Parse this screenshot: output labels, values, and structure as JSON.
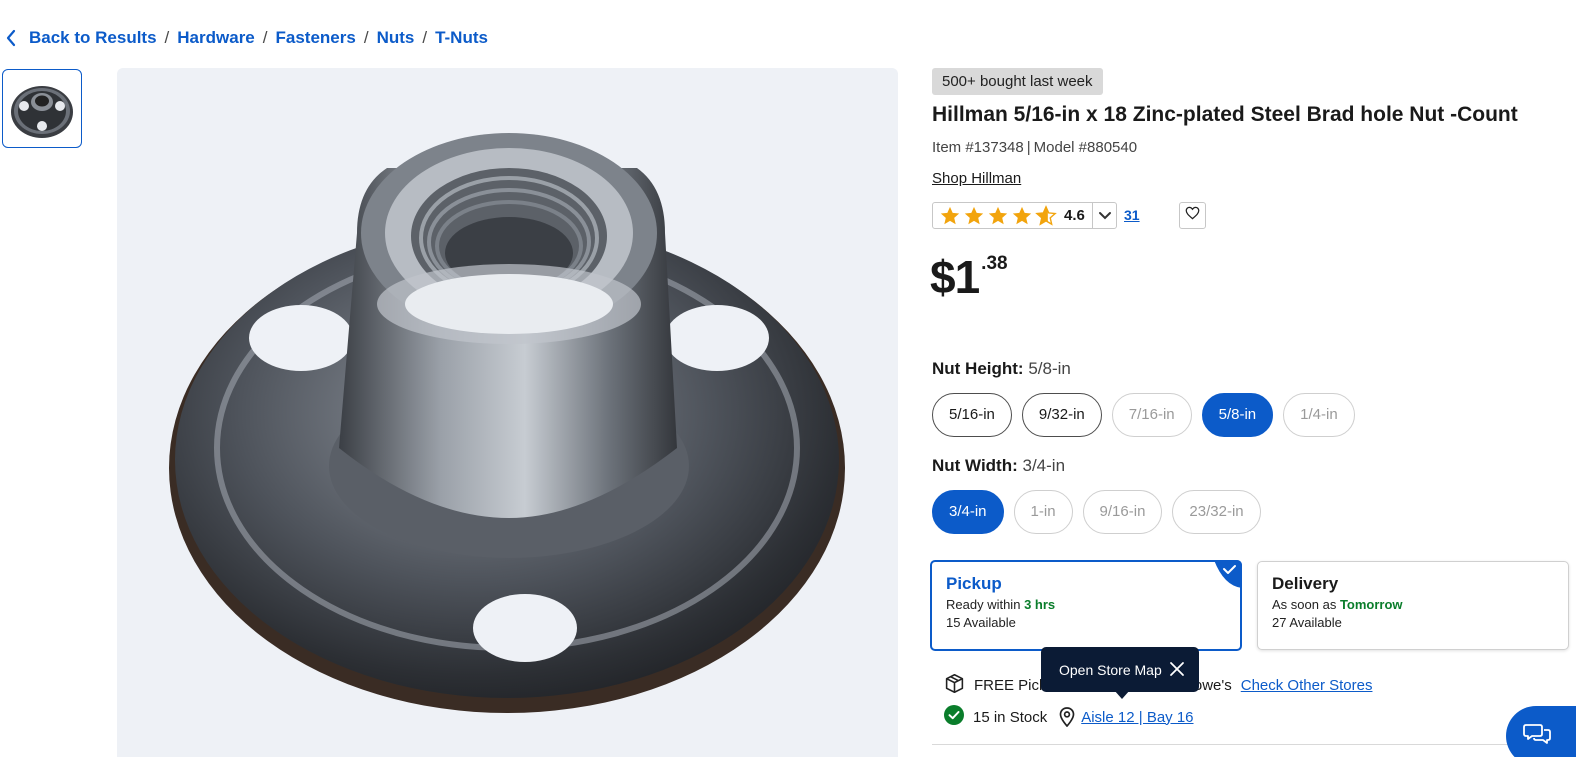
{
  "breadcrumb": {
    "back_label": "Back to Results",
    "items": [
      "Hardware",
      "Fasteners",
      "Nuts",
      "T-Nuts"
    ],
    "separator": "/"
  },
  "product": {
    "badge": "500+ bought last week",
    "title": "Hillman 5/16-in x 18 Zinc-plated Steel Brad hole Nut -Count",
    "item_number": "Item #137348",
    "model_number": "Model #880540",
    "id_separator": "|",
    "shop_link": "Shop Hillman",
    "rating": "4.6",
    "review_count": "31",
    "price_dollars": "$1",
    "price_cents": ".38"
  },
  "options": {
    "nut_height": {
      "label": "Nut Height:",
      "selected": "5/8-in",
      "choices": [
        {
          "label": "5/16-in",
          "state": "available"
        },
        {
          "label": "9/32-in",
          "state": "available"
        },
        {
          "label": "7/16-in",
          "state": "disabled"
        },
        {
          "label": "5/8-in",
          "state": "selected"
        },
        {
          "label": "1/4-in",
          "state": "disabled"
        }
      ]
    },
    "nut_width": {
      "label": "Nut Width:",
      "selected": "3/4-in",
      "choices": [
        {
          "label": "3/4-in",
          "state": "selected"
        },
        {
          "label": "1-in",
          "state": "disabled"
        },
        {
          "label": "9/16-in",
          "state": "disabled"
        },
        {
          "label": "23/32-in",
          "state": "disabled"
        }
      ]
    }
  },
  "fulfillment": {
    "pickup": {
      "title": "Pickup",
      "ready_prefix": "Ready within",
      "ready_time": "3 hrs",
      "available": "15 Available"
    },
    "delivery": {
      "title": "Delivery",
      "soon_prefix": "As soon as",
      "soon_time": "Tomorrow",
      "available": "27 Available"
    }
  },
  "tooltip": {
    "text": "Open Store Map"
  },
  "availability": {
    "free_pickup_text": "FREE Picku",
    "store_suffix": "owe's",
    "check_other_stores": "Check Other Stores",
    "stock_text": "15 in Stock",
    "aisle_link": "Aisle 12 | Bay 16"
  },
  "colors": {
    "brand_blue": "#0c5bc9",
    "green": "#0a7d2b",
    "star": "#f2a40d",
    "tooltip_bg": "#0b1b35"
  },
  "icons": {
    "back": "chevron-left-icon",
    "star": "star-icon",
    "dropdown": "chevron-down-icon",
    "favorite": "heart-icon",
    "package": "package-icon",
    "check": "check-circle-icon",
    "location": "map-pin-icon",
    "close": "close-icon",
    "chat": "chat-icon"
  }
}
